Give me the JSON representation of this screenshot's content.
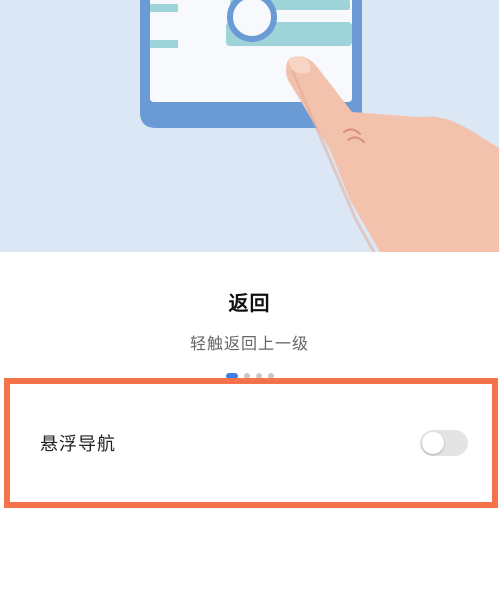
{
  "guide": {
    "title": "返回",
    "subtitle": "轻触返回上一级",
    "page_indicator": {
      "total": 4,
      "current": 1
    }
  },
  "setting": {
    "label": "悬浮导航",
    "toggle_on": false
  },
  "colors": {
    "illustration_bg": "#dce7f5",
    "highlight_border": "#f5734a",
    "toggle_off": "#e4e4e4",
    "indicator_active": "#3d7ee6"
  }
}
